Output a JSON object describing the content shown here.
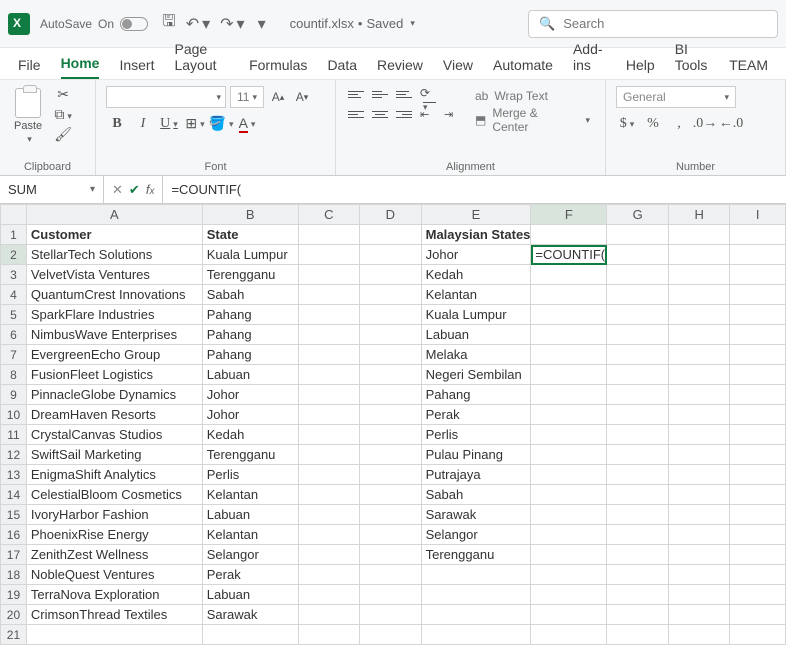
{
  "title": {
    "autosave_label": "AutoSave",
    "autosave_state": "On",
    "filename": "countif.xlsx",
    "saved_state": "Saved",
    "search_placeholder": "Search"
  },
  "tabs": [
    "File",
    "Home",
    "Insert",
    "Page Layout",
    "Formulas",
    "Data",
    "Review",
    "View",
    "Automate",
    "Add-ins",
    "Help",
    "BI Tools",
    "TEAM"
  ],
  "active_tab_index": 1,
  "ribbon": {
    "clipboard": {
      "label": "Clipboard",
      "paste": "Paste"
    },
    "font": {
      "label": "Font",
      "size": "11"
    },
    "alignment": {
      "label": "Alignment",
      "wrap": "Wrap Text",
      "merge": "Merge & Center"
    },
    "number": {
      "label": "Number",
      "format": "General"
    }
  },
  "namebox": "SUM",
  "formula": "=COUNTIF(",
  "columns": [
    "A",
    "B",
    "C",
    "D",
    "E",
    "F",
    "G",
    "H",
    "I"
  ],
  "selected_col": "F",
  "selected_row": 2,
  "headers": {
    "a1": "Customer",
    "b1": "State",
    "e1": "Malaysian States"
  },
  "f2": "=COUNTIF(",
  "customers": [
    "StellarTech Solutions",
    "VelvetVista Ventures",
    "QuantumCrest Innovations",
    "SparkFlare Industries",
    "NimbusWave Enterprises",
    "EvergreenEcho Group",
    "FusionFleet Logistics",
    "PinnacleGlobe Dynamics",
    "DreamHaven Resorts",
    "CrystalCanvas Studios",
    "SwiftSail Marketing",
    "EnigmaShift Analytics",
    "CelestialBloom Cosmetics",
    "IvoryHarbor Fashion",
    "PhoenixRise Energy",
    "ZenithZest Wellness",
    "NobleQuest Ventures",
    "TerraNova Exploration",
    "CrimsonThread Textiles"
  ],
  "states": [
    "Kuala Lumpur",
    "Terengganu",
    "Sabah",
    "Pahang",
    "Pahang",
    "Pahang",
    "Labuan",
    "Johor",
    "Johor",
    "Kedah",
    "Terengganu",
    "Perlis",
    "Kelantan",
    "Labuan",
    "Kelantan",
    "Selangor",
    "Perak",
    "Labuan",
    "Sarawak"
  ],
  "malaysian_states": [
    "Johor",
    "Kedah",
    "Kelantan",
    "Kuala Lumpur",
    "Labuan",
    "Melaka",
    "Negeri Sembilan",
    "Pahang",
    "Perak",
    "Perlis",
    "Pulau Pinang",
    "Putrajaya",
    "Sabah",
    "Sarawak",
    "Selangor",
    "Terengganu"
  ]
}
